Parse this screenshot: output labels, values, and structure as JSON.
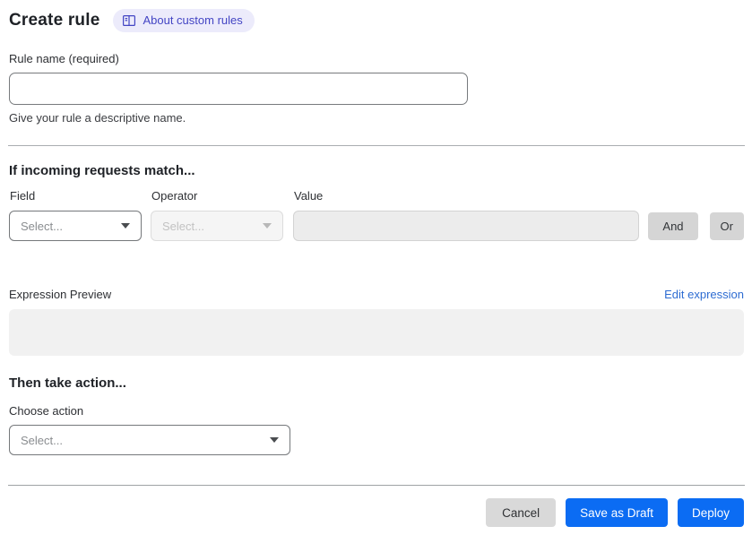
{
  "header": {
    "title": "Create rule",
    "about_link": {
      "label": "About custom rules",
      "icon": "book-icon"
    }
  },
  "rule_name": {
    "label": "Rule name (required)",
    "value": "",
    "helper": "Give your rule a descriptive name."
  },
  "match": {
    "heading": "If incoming requests match...",
    "field": {
      "label": "Field",
      "placeholder": "Select...",
      "enabled": true
    },
    "operator": {
      "label": "Operator",
      "placeholder": "Select...",
      "enabled": false
    },
    "value": {
      "label": "Value",
      "value": "",
      "enabled": false
    },
    "and_label": "And",
    "or_label": "Or"
  },
  "expression": {
    "label": "Expression Preview",
    "edit_link_label": "Edit expression",
    "preview_value": ""
  },
  "action": {
    "heading": "Then take action...",
    "label": "Choose action",
    "placeholder": "Select..."
  },
  "footer": {
    "cancel_label": "Cancel",
    "save_draft_label": "Save as Draft",
    "deploy_label": "Deploy"
  },
  "icons": {
    "about_badge": "book-icon",
    "select_caret": "chevron-down-icon"
  },
  "colors": {
    "accent_blue": "#0b6cf3",
    "link_blue": "#2d6cd2",
    "badge_bg": "#ecebfb",
    "badge_text": "#4345c4",
    "disabled_bg": "#f5f5f5",
    "preview_bg": "#f1f1f1",
    "button_gray": "#d9d9d9"
  }
}
